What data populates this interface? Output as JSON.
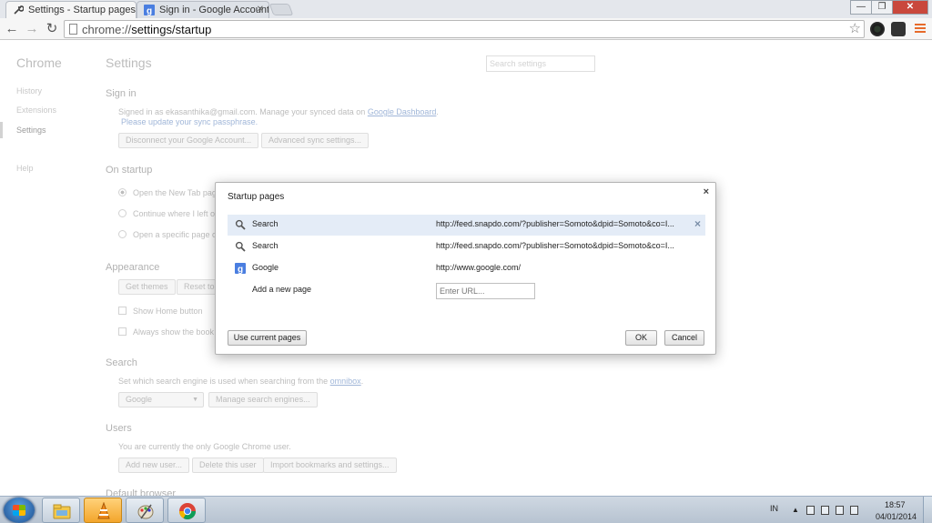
{
  "browser": {
    "tabs": [
      {
        "title": "Settings - Startup pages",
        "active": true,
        "icon": "wrench-icon"
      },
      {
        "title": "Sign in - Google Accounts",
        "active": false,
        "icon": "google-g-icon"
      }
    ],
    "window_buttons": {
      "minimize": "—",
      "restore": "❐",
      "close": "✕"
    },
    "url_scheme": "chrome://",
    "url_rest": "settings/startup"
  },
  "sidebar": {
    "title": "Chrome",
    "items": [
      "History",
      "Extensions",
      "Settings",
      "Help"
    ]
  },
  "settings": {
    "title": "Settings",
    "search_placeholder": "Search settings",
    "signin": {
      "heading": "Sign in",
      "text": "Signed in as ekasanthika@gmail.com. Manage your synced data on",
      "dashboard_link": "Google Dashboard",
      "passphrase_link": "Please update your sync passphrase.",
      "disconnect_btn": "Disconnect your Google Account...",
      "advanced_btn": "Advanced sync settings..."
    },
    "startup": {
      "heading": "On startup",
      "options": [
        "Open the New Tab pag",
        "Continue where I left o",
        "Open a specific page o"
      ]
    },
    "appearance": {
      "heading": "Appearance",
      "get_themes": "Get themes",
      "reset": "Reset to",
      "show_home": "Show Home button",
      "show_bookmarks": "Always show the book"
    },
    "search": {
      "heading": "Search",
      "text": "Set which search engine is used when searching from the",
      "omnibox_link": "omnibox",
      "engine": "Google",
      "manage_btn": "Manage search engines..."
    },
    "users": {
      "heading": "Users",
      "text": "You are currently the only Google Chrome user.",
      "add_btn": "Add new user...",
      "delete_btn": "Delete this user",
      "import_btn": "Import bookmarks and settings..."
    },
    "default_browser": {
      "heading": "Default browser"
    }
  },
  "dialog": {
    "title": "Startup pages",
    "close": "×",
    "pages": [
      {
        "name": "Search",
        "url": "http://feed.snapdo.com/?publisher=Somoto&dpid=Somoto&co=I...",
        "icon": "search-icon"
      },
      {
        "name": "Search",
        "url": "http://feed.snapdo.com/?publisher=Somoto&dpid=Somoto&co=I...",
        "icon": "search-icon"
      },
      {
        "name": "Google",
        "url": "http://www.google.com/",
        "icon": "google-g-icon"
      }
    ],
    "add_label": "Add a new page",
    "url_placeholder": "Enter URL...",
    "remove": "×",
    "use_current": "Use current pages",
    "ok": "OK",
    "cancel": "Cancel"
  },
  "taskbar": {
    "language": "IN",
    "time": "18:57",
    "date": "04/01/2014"
  },
  "colors": {
    "accent": "#6d8fc4",
    "highlight_row": "#e4ecf7",
    "google_blue": "#4a7ee0"
  }
}
